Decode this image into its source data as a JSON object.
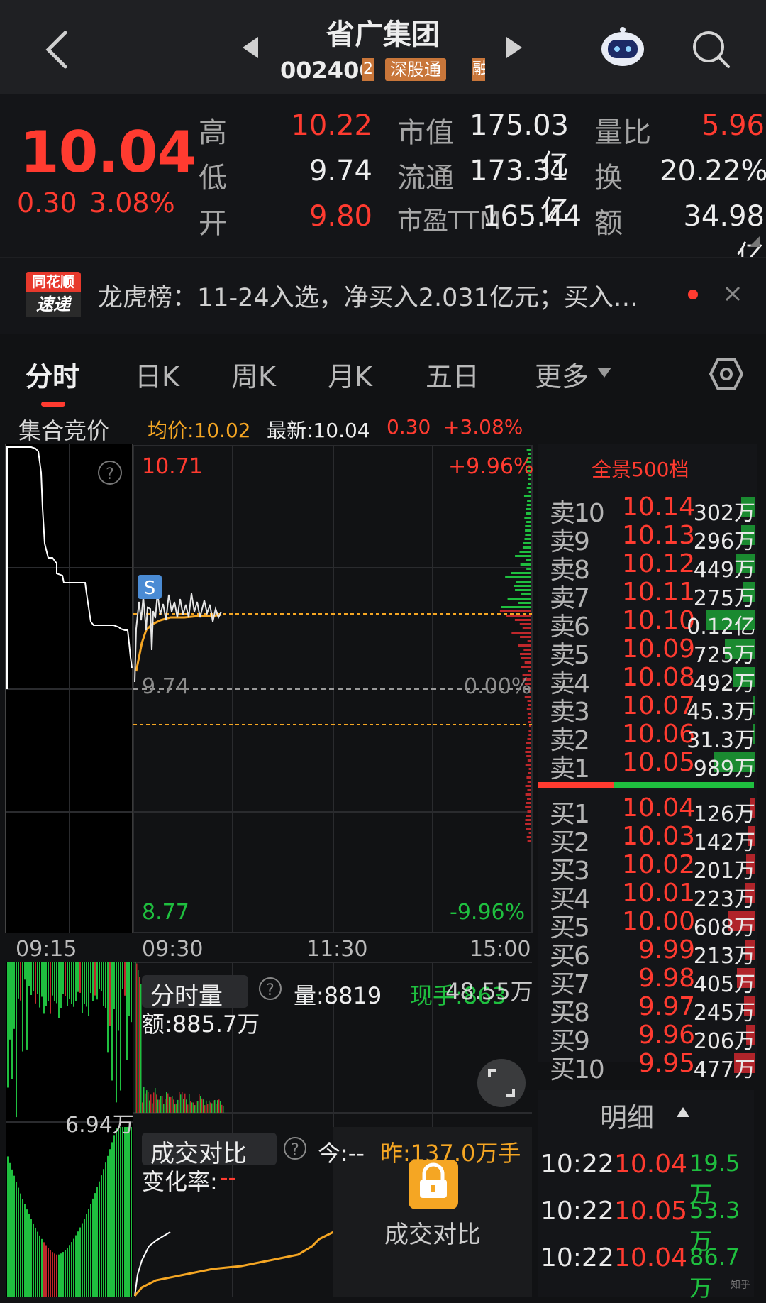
{
  "header": {
    "title": "省广集团",
    "code": "002400",
    "badge_partial": "2",
    "badge": "深股通",
    "badge_partial2": "融"
  },
  "quote": {
    "price": "10.04",
    "change": "0.30",
    "change_pct": "3.08%",
    "high_label": "高",
    "high": "10.22",
    "low_label": "低",
    "low": "9.74",
    "open_label": "开",
    "open": "9.80",
    "mktcap_label": "市值",
    "mktcap": "175.03亿",
    "float_label": "流通",
    "float": "173.31亿",
    "pe_label": "市盈TTM",
    "pe": "165.44",
    "vr_label": "量比",
    "vr": "5.96",
    "turn_label": "换",
    "turn": "20.22%",
    "amt_label": "额",
    "amt": "34.98亿"
  },
  "news": {
    "logo_top": "同花顺",
    "logo_bottom": "速递",
    "text": "龙虎榜：11-24入选，净买入2.031亿元；买入…"
  },
  "tabs": [
    "分时",
    "日K",
    "周K",
    "月K",
    "五日",
    "更多"
  ],
  "chart_header": {
    "auction": "集合竞价",
    "avg": "均价:10.02",
    "latest": "最新:10.04",
    "chg": "0.30",
    "pct": "+3.08%"
  },
  "chart_labels": {
    "top_price": "10.71",
    "top_pct": "+9.96%",
    "mid_price": "9.74",
    "mid_pct": "0.00%",
    "bot_price": "8.77",
    "bot_pct": "-9.96%",
    "time_0915": "09:15",
    "time_0930": "09:30",
    "time_1130": "11:30",
    "time_1500": "15:00",
    "s_marker": "S"
  },
  "volume_panel": {
    "title": "分时量",
    "vol": "量:8819",
    "now": "现手:863",
    "amount_right": "48.55万",
    "amount": "额:885.7万",
    "auction_vol": "6.94万"
  },
  "compare_panel": {
    "title": "成交对比",
    "today": "今:--",
    "yesterday": "昨:137.0万手",
    "rate_label": "变化率:",
    "rate_val": "--",
    "overlay_label": "成交对比"
  },
  "orderbook": {
    "title": "全景500档",
    "asks": [
      {
        "k": "卖10",
        "p": "10.14",
        "v": "302万",
        "w": 0.28
      },
      {
        "k": "卖9",
        "p": "10.13",
        "v": "296万",
        "w": 0.28
      },
      {
        "k": "卖8",
        "p": "10.12",
        "v": "449万",
        "w": 0.4
      },
      {
        "k": "卖7",
        "p": "10.11",
        "v": "275万",
        "w": 0.26
      },
      {
        "k": "卖6",
        "p": "10.10",
        "v": "0.12亿",
        "w": 1.0
      },
      {
        "k": "卖5",
        "p": "10.09",
        "v": "725万",
        "w": 0.62
      },
      {
        "k": "卖4",
        "p": "10.08",
        "v": "492万",
        "w": 0.44
      },
      {
        "k": "卖3",
        "p": "10.07",
        "v": "45.3万",
        "w": 0.05
      },
      {
        "k": "卖2",
        "p": "10.06",
        "v": "31.3万",
        "w": 0.04
      },
      {
        "k": "卖1",
        "p": "10.05",
        "v": "989万",
        "w": 0.85
      }
    ],
    "bids": [
      {
        "k": "买1",
        "p": "10.04",
        "v": "126万",
        "w": 0.12
      },
      {
        "k": "买2",
        "p": "10.03",
        "v": "142万",
        "w": 0.14
      },
      {
        "k": "买3",
        "p": "10.02",
        "v": "201万",
        "w": 0.19
      },
      {
        "k": "买4",
        "p": "10.01",
        "v": "223万",
        "w": 0.21
      },
      {
        "k": "买5",
        "p": "10.00",
        "v": "608万",
        "w": 0.55
      },
      {
        "k": "买6",
        "p": "9.99",
        "v": "213万",
        "w": 0.2
      },
      {
        "k": "买7",
        "p": "9.98",
        "v": "405万",
        "w": 0.37
      },
      {
        "k": "买8",
        "p": "9.97",
        "v": "245万",
        "w": 0.23
      },
      {
        "k": "买9",
        "p": "9.96",
        "v": "206万",
        "w": 0.19
      },
      {
        "k": "买10",
        "p": "9.95",
        "v": "477万",
        "w": 0.43
      }
    ],
    "ratio_red": 0.35
  },
  "detail": {
    "title": "明细",
    "rows": [
      {
        "t": "10:22",
        "p": "10.04",
        "v": "19.5万"
      },
      {
        "t": "10:22",
        "p": "10.05",
        "v": "53.3万"
      },
      {
        "t": "10:22",
        "p": "10.04",
        "v": "86.7万"
      }
    ]
  },
  "colors": {
    "up": "#ff3b30",
    "down": "#1fbf3f",
    "avg_line": "#f5a623",
    "badge": "#c8763a"
  },
  "watermark": "知乎"
}
